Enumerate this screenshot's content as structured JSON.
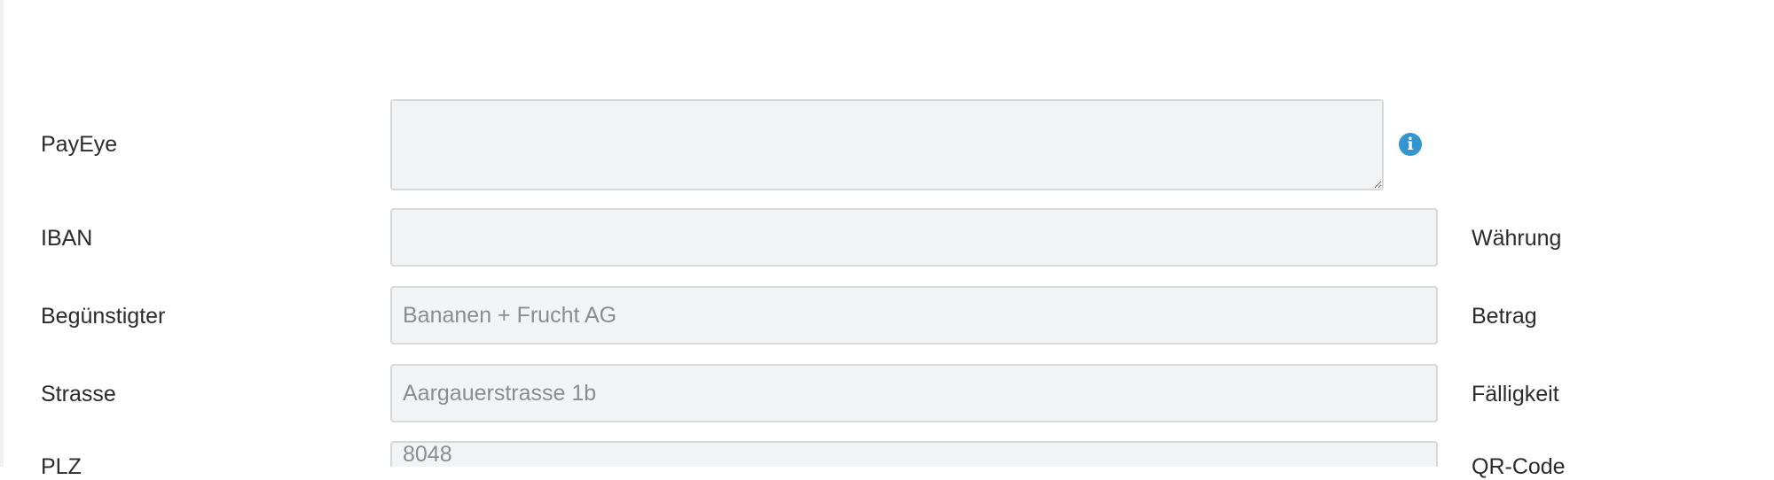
{
  "form": {
    "payeye": {
      "label": "PayEye",
      "value": ""
    },
    "iban": {
      "label": "IBAN",
      "value": ""
    },
    "beneficiary": {
      "label": "Begünstigter",
      "value": "Bananen + Frucht AG"
    },
    "street": {
      "label": "Strasse",
      "value": "Aargauerstrasse 1b"
    },
    "plz": {
      "label": "PLZ",
      "value": "8048"
    }
  },
  "right_labels": {
    "currency": "Währung",
    "amount": "Betrag",
    "due_date": "Fälligkeit",
    "partial": "QR-Code"
  },
  "icons": {
    "info": {
      "name": "info-icon",
      "glyph": "i",
      "color": "#3596cf"
    }
  }
}
